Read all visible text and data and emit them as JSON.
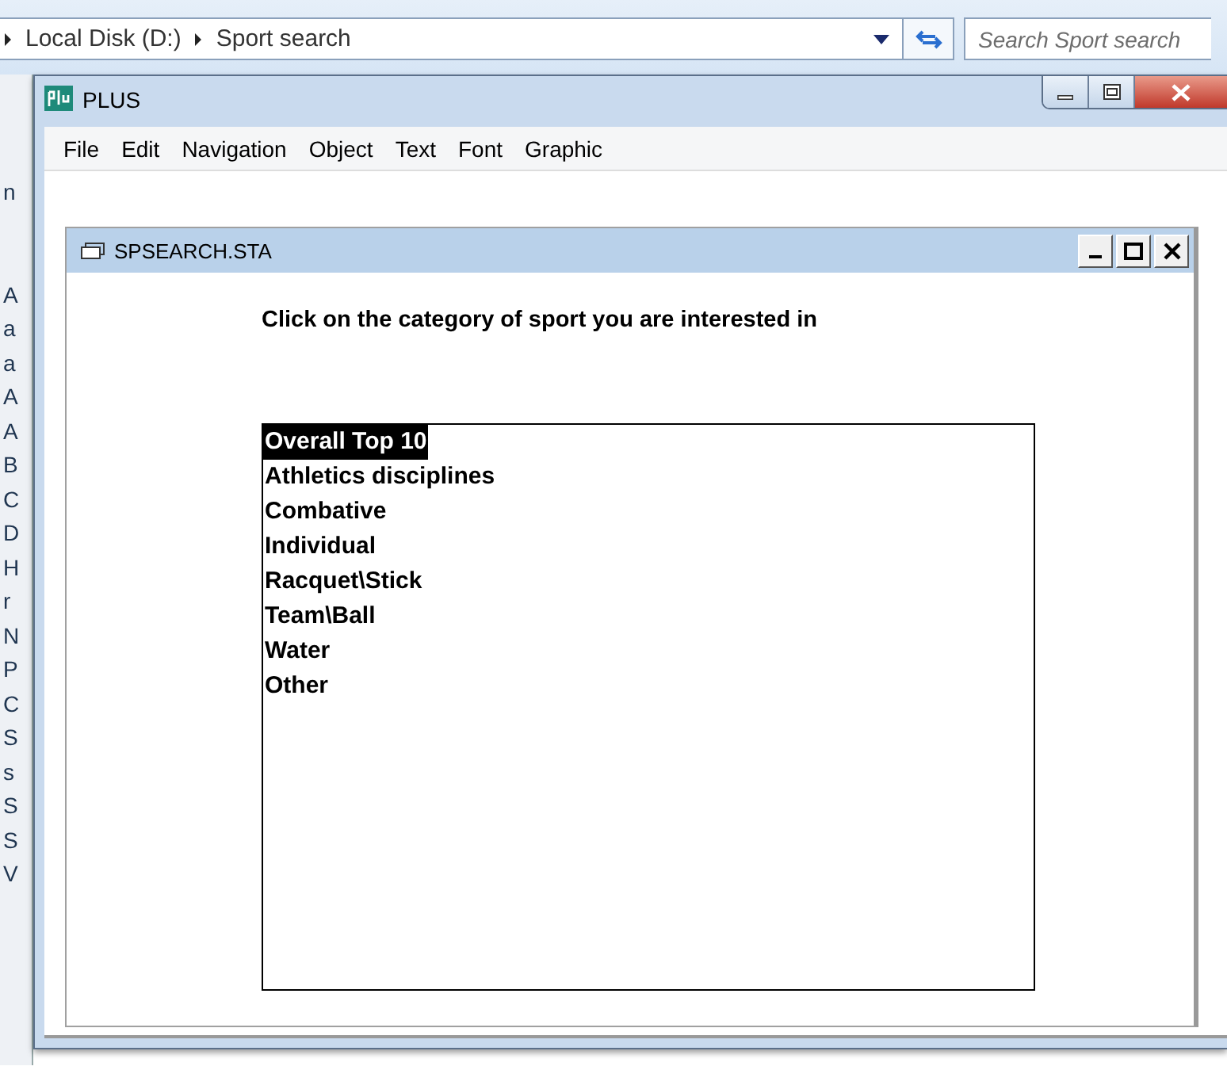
{
  "explorer": {
    "breadcrumb": [
      "Local Disk (D:)",
      "Sport search"
    ],
    "search": {
      "placeholder": "Search Sport search"
    },
    "list_items": [
      "n",
      "A",
      "a",
      "a",
      "A",
      "A",
      "B",
      "C",
      "D",
      "H",
      "r",
      "N",
      "P",
      "C",
      "S",
      "s",
      "S",
      "S",
      "V"
    ]
  },
  "window": {
    "title": "PLUS"
  },
  "menu": [
    "File",
    "Edit",
    "Navigation",
    "Object",
    "Text",
    "Font",
    "Graphic"
  ],
  "child_window": {
    "title": "SPSEARCH.STA",
    "prompt": "Click on the category of sport you are interested in",
    "listbox": {
      "items": [
        {
          "label": "Overall Top 10",
          "selected": true
        },
        {
          "label": "Athletics disciplines",
          "selected": false
        },
        {
          "label": "Combative",
          "selected": false
        },
        {
          "label": "Individual",
          "selected": false
        },
        {
          "label": "Racquet\\Stick",
          "selected": false
        },
        {
          "label": "Team\\Ball",
          "selected": false
        },
        {
          "label": "Water",
          "selected": false
        },
        {
          "label": "Other",
          "selected": false
        }
      ]
    }
  }
}
